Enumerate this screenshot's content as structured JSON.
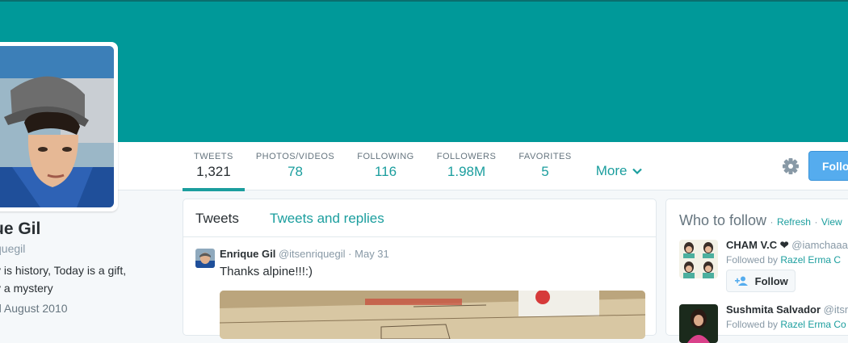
{
  "header": {
    "banner_color": "#009999",
    "accent": "#1b9e9e",
    "follow_label": "Follow",
    "settings_icon": "gear-icon"
  },
  "stats": [
    {
      "label": "TWEETS",
      "value": "1,321",
      "active": true
    },
    {
      "label": "PHOTOS/VIDEOS",
      "value": "78"
    },
    {
      "label": "FOLLOWING",
      "value": "116"
    },
    {
      "label": "FOLLOWERS",
      "value": "1.98M"
    },
    {
      "label": "FAVORITES",
      "value": "5"
    }
  ],
  "more_label": "More",
  "profile": {
    "name": "ue Gil",
    "handle": "quegil",
    "bio_line1": "y is history, Today is a gift,",
    "bio_line2": "y a mystery",
    "joined": "d August 2010"
  },
  "timeline": {
    "tabs": [
      "Tweets",
      "Tweets and replies"
    ],
    "tweet": {
      "name": "Enrique Gil",
      "handle": "@itsenriquegil",
      "sep": "·",
      "date": "May 31",
      "text": "Thanks alpine!!!:)"
    }
  },
  "who_to_follow": {
    "title": "Who to follow",
    "sep": "·",
    "refresh": "Refresh",
    "view_all": "View",
    "suggestions": [
      {
        "name": "CHAM V.C",
        "heart": "❤",
        "handle": "@iamchaaar",
        "followed_by": "Followed by",
        "by_name": "Razel Erma C",
        "button": "Follow"
      },
      {
        "name": "Sushmita Salvador",
        "handle": "@itsm",
        "followed_by": "Followed by",
        "by_name": "Razel Erma Co"
      }
    ]
  }
}
